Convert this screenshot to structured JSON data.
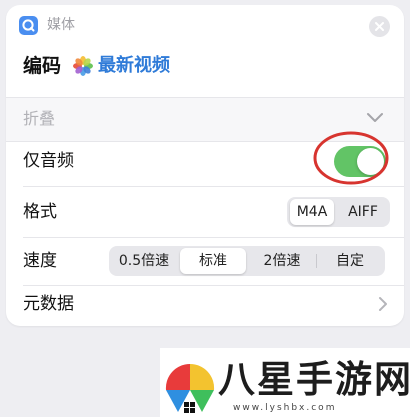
{
  "header": {
    "app_name": "媒体",
    "app_icon": "media-app-icon",
    "close_icon": "close-icon"
  },
  "action": {
    "verb": "编码",
    "variable_label": "最新视频",
    "variable_icon": "photos-icon",
    "variable_color": "#2f7bd8"
  },
  "collapse": {
    "label": "折叠",
    "icon": "chevron-down-icon"
  },
  "audio_only": {
    "label": "仅音频",
    "on": true,
    "toggle_color": "#62c466",
    "annotation_color": "#d7342f"
  },
  "format": {
    "label": "格式",
    "options": [
      "M4A",
      "AIFF"
    ],
    "selected": "M4A"
  },
  "speed": {
    "label": "速度",
    "options": [
      "0.5倍速",
      "标准",
      "2倍速",
      "自定"
    ],
    "selected": "标准"
  },
  "metadata": {
    "label": "元数据",
    "icon": "chevron-right-icon"
  },
  "watermark": {
    "title": "八星手游网",
    "url": "www.lyshbx.com"
  }
}
